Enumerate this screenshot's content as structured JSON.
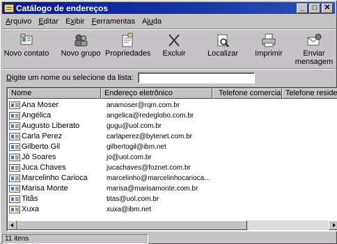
{
  "window": {
    "title": "Catálogo de endereços",
    "controls": {
      "minimize": "_",
      "maximize": "□",
      "close": "✕"
    }
  },
  "menu": [
    {
      "pre": "",
      "u": "A",
      "post": "rquivo"
    },
    {
      "pre": "",
      "u": "E",
      "post": "ditar"
    },
    {
      "pre": "E",
      "u": "x",
      "post": "ibir"
    },
    {
      "pre": "",
      "u": "F",
      "post": "erramentas"
    },
    {
      "pre": "Aj",
      "u": "u",
      "post": "da"
    }
  ],
  "toolbar": [
    {
      "label": "Novo contato",
      "icon": "new-contact-icon"
    },
    {
      "label": "Novo grupo",
      "icon": "new-group-icon"
    },
    {
      "label": "Propriedades",
      "icon": "properties-icon"
    },
    {
      "label": "Excluir",
      "icon": "delete-icon"
    },
    {
      "label": "Localizar",
      "icon": "find-icon"
    },
    {
      "label": "Imprimir",
      "icon": "print-icon"
    },
    {
      "label": "Enviar",
      "label2": "mensagem",
      "icon": "send-message-icon"
    }
  ],
  "search": {
    "label_pre": "",
    "label_u": "D",
    "label_post": "igite um nome ou selecione da lista:",
    "value": ""
  },
  "columns": [
    "Nome",
    "Endereço eletrônico",
    "Telefone comercial",
    "Telefone residen"
  ],
  "contacts": [
    {
      "name": "Ana Moser",
      "email": "anamoser@rqm.com.br"
    },
    {
      "name": "Angélica",
      "email": "angelica@redeglobo.com.br"
    },
    {
      "name": "Augusto Liberato",
      "email": "gugu@uol.com.br"
    },
    {
      "name": "Carla Perez",
      "email": "carlaperez@bytenet.com.br"
    },
    {
      "name": "Gilberto Gil",
      "email": "gilbertogil@ibm.net"
    },
    {
      "name": "Jô Soares",
      "email": "jo@uol.com.br"
    },
    {
      "name": "Juca Chaves",
      "email": "jucachaves@foznet.com.br"
    },
    {
      "name": "Marcelinho Carioca",
      "email": "marcelinho@marcelinhocarioca..."
    },
    {
      "name": "Marisa Monte",
      "email": "marisa@marisamonte.com.br"
    },
    {
      "name": "Titãs",
      "email": "titas@uol.com.br"
    },
    {
      "name": "Xuxa",
      "email": "xuxa@ibm.net"
    }
  ],
  "status": {
    "text": "11 itens"
  }
}
